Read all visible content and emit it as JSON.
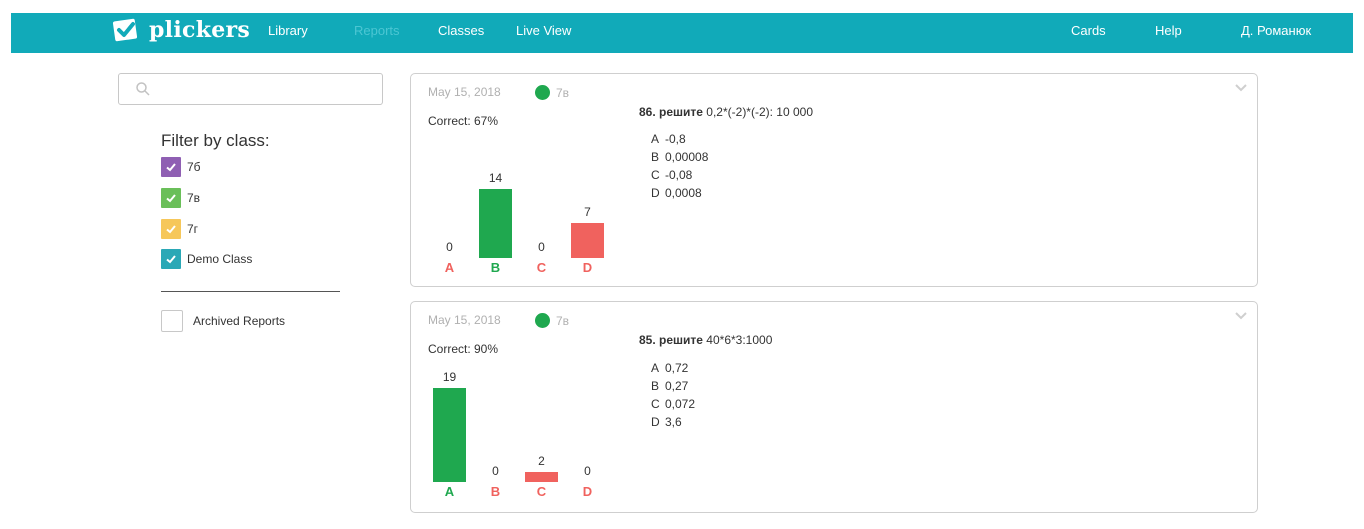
{
  "colors": {
    "topbar": "#11aab9",
    "active_nav": "#4cc6d3",
    "correct": "#1fa84f",
    "incorrect": "#f0625e",
    "class_76": "#8f5fb3",
    "class_7v": "#6abf59",
    "class_7g": "#f6c75a",
    "class_demo": "#2aa8b6"
  },
  "nav": {
    "brand": "plickers",
    "items": [
      "Library",
      "Reports",
      "Classes",
      "Live View"
    ],
    "right": [
      "Cards",
      "Help",
      "Д. Романюк"
    ]
  },
  "search": {
    "value": "",
    "placeholder": ""
  },
  "filters": {
    "title": "Filter by class:",
    "classes": [
      {
        "label": "7б",
        "checked": true
      },
      {
        "label": "7в",
        "checked": true
      },
      {
        "label": "7г",
        "checked": true
      },
      {
        "label": "Demo Class",
        "checked": true
      }
    ],
    "archived_label": "Archived Reports"
  },
  "reports": [
    {
      "date": "May 15, 2018",
      "class": "7в",
      "correct": "Correct: 67%",
      "question_num": "86. решите",
      "question_text": "0,2*(-2)*(-2): 10 000",
      "answers": [
        {
          "letter": "A",
          "text": "-0,8"
        },
        {
          "letter": "B",
          "text": "0,00008"
        },
        {
          "letter": "C",
          "text": "-0,08"
        },
        {
          "letter": "D",
          "text": "0,0008"
        }
      ],
      "chart": {
        "labels": [
          "A",
          "B",
          "C",
          "D"
        ],
        "values": [
          0,
          14,
          0,
          7
        ],
        "correct_index": 1
      }
    },
    {
      "date": "May 15, 2018",
      "class": "7в",
      "correct": "Correct: 90%",
      "question_num": "85. решите",
      "question_text": "40*6*3:1000",
      "answers": [
        {
          "letter": "A",
          "text": "0,72"
        },
        {
          "letter": "B",
          "text": "0,27"
        },
        {
          "letter": "C",
          "text": "0,072"
        },
        {
          "letter": "D",
          "text": "3,6"
        }
      ],
      "chart": {
        "labels": [
          "A",
          "B",
          "C",
          "D"
        ],
        "values": [
          19,
          0,
          2,
          0
        ],
        "correct_index": 0
      }
    }
  ]
}
